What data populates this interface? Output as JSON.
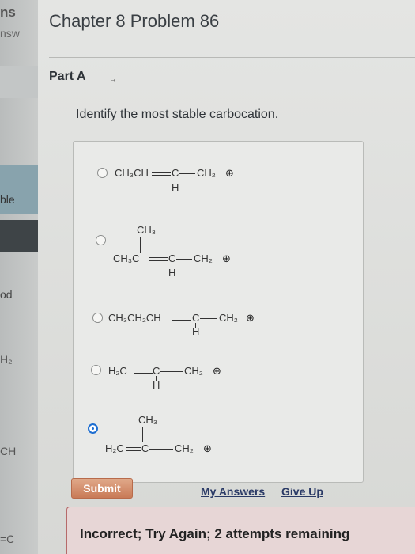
{
  "sidebar": {
    "fragments": [
      "ns",
      "nsw",
      "ble",
      "od",
      "H₂",
      "CH",
      "=C"
    ]
  },
  "header": {
    "title": "Chapter 8 Problem 86"
  },
  "part": {
    "label": "Part A",
    "arrow": "→"
  },
  "question": "Identify the most stable carbocation.",
  "options": [
    {
      "main": "CH₃CH",
      "mid": "C",
      "right": "CH₂",
      "below": "H",
      "selected": false
    },
    {
      "top": "CH₃",
      "main": "CH₃C",
      "mid": "C",
      "right": "CH₂",
      "below": "H",
      "selected": false
    },
    {
      "main": "CH₃CH₂CH",
      "mid": "C",
      "right": "CH₂",
      "below": "H",
      "selected": false
    },
    {
      "main": "H₂C",
      "mid": "C",
      "right": "CH₂",
      "below": "H",
      "selected": false
    },
    {
      "top": "CH₃",
      "main": "H₂C",
      "mid": "C",
      "right": "CH₂",
      "selected": true
    }
  ],
  "plus_symbol": "⊕",
  "actions": {
    "submit": "Submit",
    "my_answers": "My Answers",
    "give_up": "Give Up"
  },
  "feedback": "Incorrect; Try Again; 2 attempts remaining",
  "colors": {
    "submit": "#c97a57",
    "selected_radio": "#1f6fd1",
    "feedback_bg": "#e7d6d6"
  }
}
